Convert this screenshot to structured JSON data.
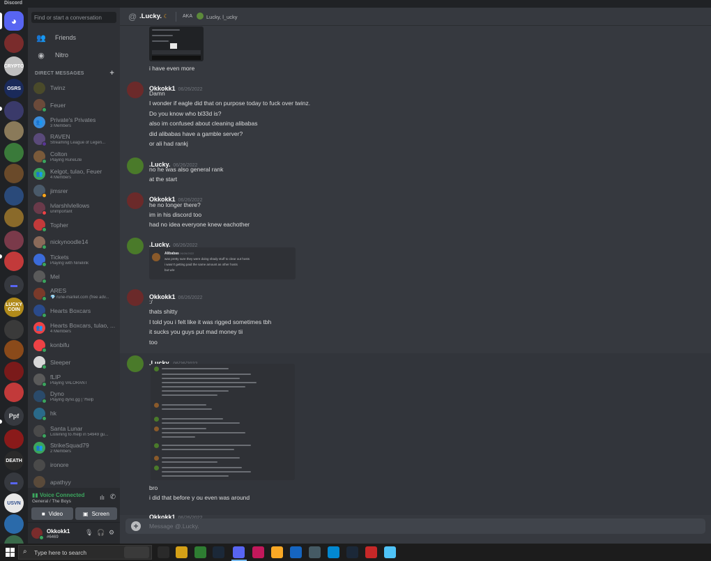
{
  "app": {
    "title": "Discord"
  },
  "dm_sidebar": {
    "search_placeholder": "Find or start a conversation",
    "nav": [
      {
        "label": "Friends",
        "icon": "friends-icon"
      },
      {
        "label": "Nitro",
        "icon": "nitro-icon"
      }
    ],
    "section_title": "DIRECT MESSAGES",
    "conversations": [
      {
        "name": "Twinz",
        "sub": "",
        "color": "#4a4a2a",
        "status": "none"
      },
      {
        "name": "Feuer",
        "sub": "",
        "color": "#6b4a3a",
        "status": "online"
      },
      {
        "name": "Private's Privates",
        "sub": "3 Members",
        "color": "#3b8bd9",
        "status": "none"
      },
      {
        "name": "RAVEN",
        "sub": "Streaming League of Legen...",
        "color": "#5a4a7a",
        "status": "streaming"
      },
      {
        "name": "Colton",
        "sub": "Playing RuneLite",
        "color": "#7a5a3a",
        "status": "online"
      },
      {
        "name": "Kelgot, tulao, Feuer",
        "sub": "4 Members",
        "color": "#3ba55d",
        "status": "none"
      },
      {
        "name": "jimsrer",
        "sub": "",
        "color": "#4a5a6a",
        "status": "idle"
      },
      {
        "name": "lvlarshlvlellows",
        "sub": "unimportant",
        "color": "#6a3a4a",
        "status": "dnd"
      },
      {
        "name": "Topher",
        "sub": "",
        "color": "#c23a3a",
        "status": "online"
      },
      {
        "name": "nickynoodle14",
        "sub": "",
        "color": "#8a6a5a",
        "status": "online"
      },
      {
        "name": "Tickets",
        "sub": "Playing with Ninelink",
        "color": "#3b6bd9",
        "status": "online"
      },
      {
        "name": "Mel",
        "sub": "",
        "color": "#5a5a5a",
        "status": "online"
      },
      {
        "name": "ARES",
        "sub": "💎 rune-market.com (free adv...",
        "color": "#7a3a2a",
        "status": "online"
      },
      {
        "name": "Hearts Boxcars",
        "sub": "",
        "color": "#2a4a8a",
        "status": "online"
      },
      {
        "name": "Hearts Boxcars, tulao, ...",
        "sub": "4 Members",
        "color": "#ed4245",
        "status": "none"
      },
      {
        "name": "konbifu",
        "sub": "",
        "color": "#ed4245",
        "status": "online"
      },
      {
        "name": "Sleeper",
        "sub": "",
        "color": "#d8d8d8",
        "status": "online"
      },
      {
        "name": "fLIP",
        "sub": "Playing VALORANT",
        "color": "#5a5a5a",
        "status": "online"
      },
      {
        "name": "Dyno",
        "sub": "Playing dyno.gg | ?help",
        "color": "#2a4a6a",
        "status": "online"
      },
      {
        "name": "hk",
        "sub": "",
        "color": "#2a6a8a",
        "status": "online"
      },
      {
        "name": "Santa Lunar",
        "sub": "Listening to /help in 54949 gu...",
        "color": "#4a4a4a",
        "status": "online"
      },
      {
        "name": "StrikeSquad79",
        "sub": "2 Members",
        "color": "#3ba55d",
        "status": "none"
      },
      {
        "name": "ironore",
        "sub": "",
        "color": "#4a4a4a",
        "status": "none"
      },
      {
        "name": "apathyy",
        "sub": "",
        "color": "#5a4a3a",
        "status": "none"
      }
    ]
  },
  "voice": {
    "status": "Voice Connected",
    "channel": "General / The Boys",
    "video_label": "Video",
    "screen_label": "Screen"
  },
  "user": {
    "name": "Okkokk1",
    "tag": "#6469"
  },
  "chat": {
    "channel_name": ".Lucky.",
    "aka_label": "AKA",
    "aka_names": "Lucky, l_ucky",
    "composer_placeholder": "Message @.Lucky.",
    "messages": [
      {
        "lines": [
          "i have even more"
        ]
      },
      {
        "author": "Okkokk1",
        "date": "06/26/2022",
        "lines": [
          "Damn",
          "I wonder if eagle did that on purpose today to fuck over twinz.",
          "Do you know who bl33d is?",
          "also im confused about cleaning alibabas",
          "did alibabas have a gamble server?",
          "or ali had rankj"
        ]
      },
      {
        "author": ".Lucky.",
        "date": "06/26/2022",
        "lines": [
          "no he was also general rank",
          "at the start"
        ]
      },
      {
        "author": "Okkokk1",
        "date": "06/26/2022",
        "lines": [
          "he no longer there?",
          "im in his discord too",
          "had no idea everyone knew eachother"
        ]
      },
      {
        "author": ".Lucky.",
        "date": "06/26/2022",
        "lines": [],
        "embed": {
          "author": "Alibabas",
          "date": "06/26/2022",
          "lines": [
            "was pretty sure they were doing shady stuff to clear out hosts",
            "i wasn't getting paid the same amount as other hosts",
            "but w/e"
          ]
        }
      },
      {
        "author": "Okkokk1",
        "date": "06/26/2022",
        "lines": [
          ":/",
          "thats shitty",
          "I told you i felt like it was rigged sometimes tbh",
          "it sucks you guys put mad money tii",
          "too"
        ]
      },
      {
        "author": ".Lucky.",
        "date": "06/26/2022",
        "lines": [
          "bro",
          "i did that before y ou even was around"
        ]
      },
      {
        "author": "Okkokk1",
        "date": "06/26/2022",
        "lines": []
      }
    ]
  },
  "servers": [
    {
      "label": "",
      "color": "#5865f2",
      "icon": "discord-home-icon"
    },
    {
      "label": "",
      "color": "#7a2c2c"
    },
    {
      "label": "CRYPTO",
      "color": "#c0c0c0"
    },
    {
      "label": "OSRS",
      "color": "#1a2a5a"
    },
    {
      "label": "",
      "color": "#3a3a6a"
    },
    {
      "label": "",
      "color": "#8a7a5a"
    },
    {
      "label": "",
      "color": "#3a7a3a"
    },
    {
      "label": "",
      "color": "#6a4a2a"
    },
    {
      "label": "",
      "color": "#2a4a7a"
    },
    {
      "label": "",
      "color": "#8a6a2a"
    },
    {
      "label": "",
      "color": "#7a3a4a"
    },
    {
      "label": "",
      "color": "#c23a3a"
    },
    {
      "label": "",
      "color": "#5865f2",
      "icon": "folder-icon"
    },
    {
      "label": "LUCKY COIN",
      "color": "#b08a1a"
    },
    {
      "label": "",
      "color": "#3a3a3a"
    },
    {
      "label": "",
      "color": "#8a4a1a"
    },
    {
      "label": "",
      "color": "#7a1a1a"
    },
    {
      "label": "",
      "color": "#c23a3a"
    },
    {
      "label": "Ppf",
      "color": "#36393f"
    },
    {
      "label": "",
      "color": "#8a1a1a"
    },
    {
      "label": "DEATH",
      "color": "#2a2a2a"
    },
    {
      "label": "",
      "color": "#5865f2",
      "icon": "folder-icon"
    },
    {
      "label": "USVN",
      "color": "#e8e8e8"
    },
    {
      "label": "",
      "color": "#2a6aaa"
    },
    {
      "label": "",
      "color": "#3a6a4a"
    }
  ],
  "taskbar": {
    "search_placeholder": "Type here to search"
  },
  "colors": {
    "online": "#3ba55d",
    "idle": "#faa61a",
    "dnd": "#ed4245",
    "streaming": "#593695",
    "accent": "#5865f2"
  }
}
